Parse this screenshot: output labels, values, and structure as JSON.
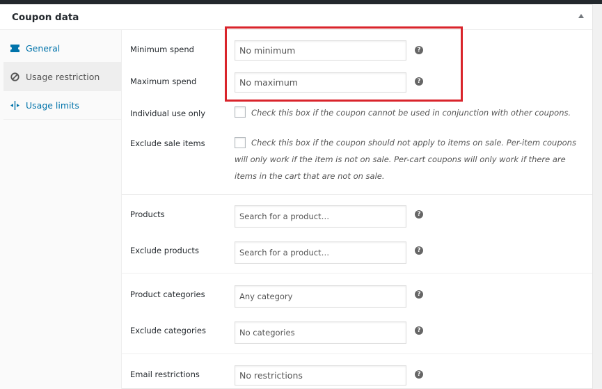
{
  "panel": {
    "title": "Coupon data"
  },
  "tabs": [
    {
      "label": "General",
      "icon": "ticket-icon"
    },
    {
      "label": "Usage restriction",
      "icon": "block-icon"
    },
    {
      "label": "Usage limits",
      "icon": "limits-icon"
    }
  ],
  "active_tab": "Usage restriction",
  "fields": {
    "minimum_spend": {
      "label": "Minimum spend",
      "placeholder": "No minimum"
    },
    "maximum_spend": {
      "label": "Maximum spend",
      "placeholder": "No maximum"
    },
    "individual_use": {
      "label": "Individual use only",
      "description": "Check this box if the coupon cannot be used in conjunction with other coupons."
    },
    "exclude_sale": {
      "label": "Exclude sale items",
      "description_lines": [
        "Check this box if the coupon should not apply to items on sale. Per-item coupons",
        "will only work if the item is not on sale. Per-cart coupons will only work if there are",
        "items in the cart that are not on sale."
      ]
    },
    "products": {
      "label": "Products",
      "placeholder": "Search for a product…"
    },
    "exclude_products": {
      "label": "Exclude products",
      "placeholder": "Search for a product…"
    },
    "product_categories": {
      "label": "Product categories",
      "placeholder": "Any category"
    },
    "exclude_categories": {
      "label": "Exclude categories",
      "placeholder": "No categories"
    },
    "email_restrictions": {
      "label": "Email restrictions",
      "placeholder": "No restrictions"
    }
  },
  "help_glyph": "?",
  "colors": {
    "link": "#0073aa",
    "highlight": "#d9242b",
    "help": "#666666"
  }
}
